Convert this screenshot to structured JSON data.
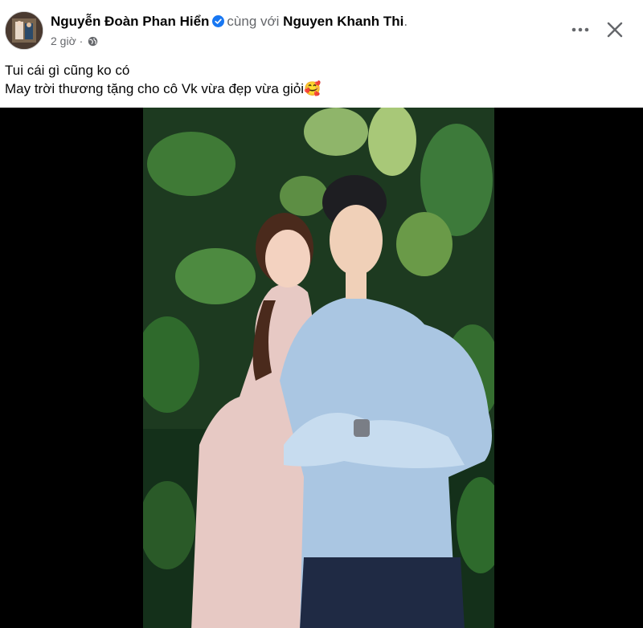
{
  "post": {
    "author_name": "Nguyễn Đoàn Phan Hiển",
    "with_text": "cùng với",
    "tagged_name": "Nguyen Khanh Thi",
    "period": ".",
    "time": "2 giờ",
    "separator": "·",
    "privacy_icon": "globe-icon",
    "text_lines": [
      "Tui cái gì cũng ko có",
      "May trời thương tặng cho cô Vk vừa đẹp vừa giỏi🥰"
    ]
  },
  "actions": {
    "more_icon": "more-dots-icon",
    "close_icon": "close-icon"
  },
  "colors": {
    "verified": "#1877f2",
    "meta": "#65676b",
    "text": "#050505",
    "photo_bg": "#000000"
  }
}
